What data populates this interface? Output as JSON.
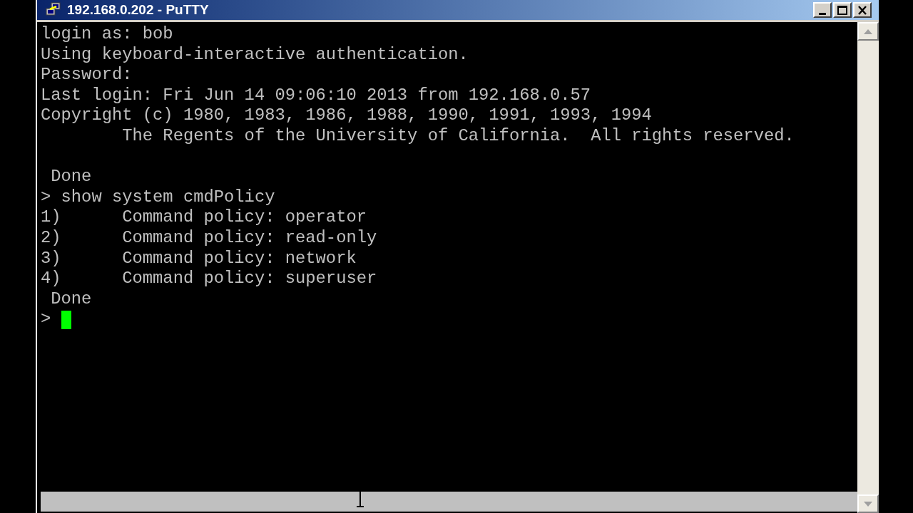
{
  "window": {
    "title": "192.168.0.202 - PuTTY"
  },
  "terminal": {
    "lines": [
      {
        "kind": "text",
        "text": "login as: bob"
      },
      {
        "kind": "text",
        "text": "Using keyboard-interactive authentication."
      },
      {
        "kind": "text",
        "text": "Password:"
      },
      {
        "kind": "text",
        "text": "Last login: Fri Jun 14 09:06:10 2013 from 192.168.0.57"
      },
      {
        "kind": "text",
        "text": "Copyright (c) 1980, 1983, 1986, 1988, 1990, 1991, 1993, 1994"
      },
      {
        "kind": "text",
        "text": "        The Regents of the University of California.  All rights reserved."
      },
      {
        "kind": "blank"
      },
      {
        "kind": "text",
        "text": " Done"
      },
      {
        "kind": "text",
        "text": "> show system cmdPolicy"
      },
      {
        "kind": "text",
        "text": "1)      Command policy: operator"
      },
      {
        "kind": "text",
        "text": "2)      Command policy: read-only"
      },
      {
        "kind": "text",
        "text": "3)      Command policy: network"
      },
      {
        "kind": "text",
        "text": "4)      Command policy: superuser"
      },
      {
        "kind": "text",
        "text": " Done"
      },
      {
        "kind": "prompt",
        "text": ">"
      }
    ]
  }
}
